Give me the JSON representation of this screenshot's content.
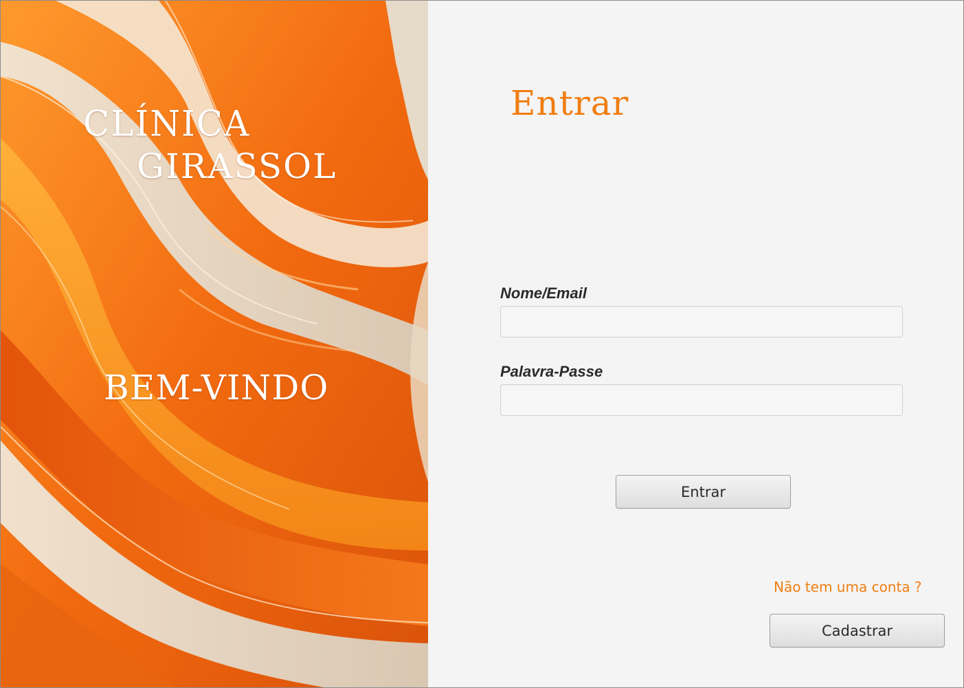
{
  "brand": {
    "line1": "CLÍNICA",
    "line2": "GIRASSOL",
    "welcome": "BEM-VINDO"
  },
  "login_form": {
    "title": "Entrar",
    "username_label": "Nome/Email",
    "username_value": "",
    "password_label": "Palavra-Passe",
    "password_value": "",
    "submit_label": "Entrar"
  },
  "signup": {
    "prompt": "Não tem uma conta ?",
    "button_label": "Cadastrar"
  },
  "theme": {
    "accent": "#f07d10",
    "panel_background": "#f4f4f4",
    "art_orange": "#f27a17",
    "art_cream": "#e9dcc8"
  }
}
